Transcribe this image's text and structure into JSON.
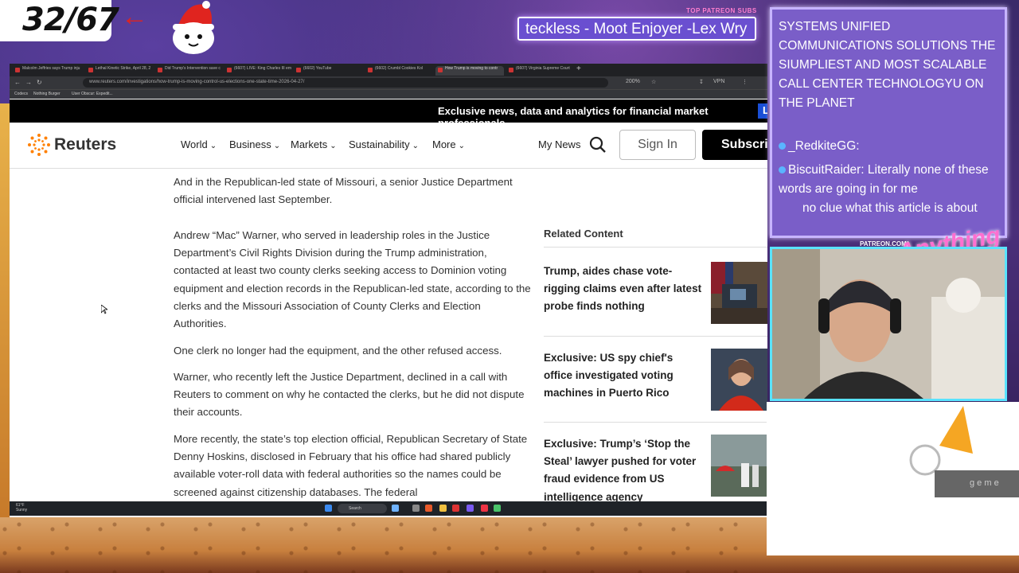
{
  "stream": {
    "counter": "32/67",
    "subs_label": "TOP PATREON SUBS",
    "ticker": "teckless - Moot Enjoyer -Lex Wry",
    "patreon_label": "PATREON.COM/",
    "logo_script": "Anything Else?",
    "tag_text": "g e m e"
  },
  "browser": {
    "tabs": [
      "Malcolm Jeffries says Trump inju",
      "Lethal Kinetic Strike, April 28, 2",
      "Did Trump's Intervention save c",
      "(6607) LIVE: King Charles III em",
      "(6602) YouTube",
      "(6602) Crumbl Cookies Kol",
      "How Trump is moving to contr",
      "(6607) Virginia Supreme Court"
    ],
    "url": "www.reuters.com/investigations/how-trump-is-moving-control-us-elections-one-state-time-2026-04-27/",
    "zoom": "200%",
    "vpn": "VPN",
    "bookmarks": [
      "Codecs",
      "Nothing Burger",
      "User Obscur: Expedit..."
    ]
  },
  "reuters": {
    "promo_text": "Exclusive news, data and analytics for financial market professionals",
    "promo_button": "Learn",
    "logo": "Reuters",
    "nav": [
      "World",
      "Business",
      "Markets",
      "Sustainability",
      "More"
    ],
    "my_news": "My News",
    "sign_in": "Sign In",
    "subscribe": "Subscribe",
    "paragraphs": [
      "And in the Republican-led state of Missouri, a senior Justice Department official intervened last September.",
      "Andrew “Mac” Warner, who served in leadership roles in the Justice Department’s Civil Rights Division during the Trump administration, contacted at least two county clerks seeking access to Dominion voting equipment and election records in the Republican-led state, according to the clerks and the Missouri Association of County Clerks and Election Authorities.",
      "One clerk no longer had the equipment, and the other refused access.",
      "Warner, who recently left the Justice Department, declined in a call with Reuters to comment on why he contacted the clerks, but he did not dispute their accounts.",
      "More recently, the state’s top election official, Republican Secretary of State Denny Hoskins, disclosed in February that his office had shared publicly available voter-roll data with federal authorities so the names could be screened against citizenship databases. The federal"
    ],
    "related_heading": "Related Content",
    "related": [
      "Trump, aides chase vote-rigging claims even after latest probe finds nothing",
      "Exclusive: US spy chief's office investigated voting machines in Puerto Rico",
      "Exclusive: Trump’s ‘Stop the Steal’ lawyer pushed for voter fraud evidence from US intelligence agency"
    ]
  },
  "taskbar": {
    "weather_temp": "61°F",
    "weather_desc": "Sunny",
    "search": "Search"
  },
  "chat": {
    "message1": "SYSTEMS UNIFIED COMMUNICATIONS SOLUTIONS THE SIUMPLIEST AND MOST SCALABLE CALL CENTER TECHNOLOGYU ON THE PLANET",
    "message2_user": "_RedkiteGG:",
    "message3": "BiscuitRaider: Literally none of these words are going in for me",
    "message4": "no clue what this article is about"
  }
}
